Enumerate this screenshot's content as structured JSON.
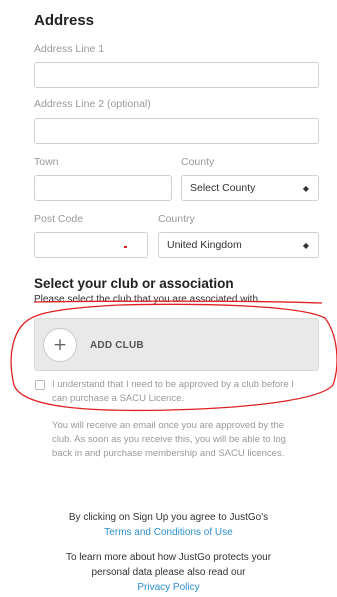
{
  "address": {
    "title": "Address",
    "line1_label": "Address Line 1",
    "line2_label": "Address Line 2 (optional)",
    "town_label": "Town",
    "county_label": "County",
    "county_value": "Select County",
    "postcode_label": "Post Code",
    "country_label": "Country",
    "country_value": "United Kingdom"
  },
  "club": {
    "title": "Select your club or association",
    "subtitle": "Please select the club that you are associated with.",
    "add_club_label": "ADD CLUB",
    "plus_symbol": "+",
    "checkbox_label_1": "I understand that I need to be approved by a club before I",
    "checkbox_label_2": "can purchase a SACU Licence.",
    "info_1": "You will receive an email once you are approved by the",
    "info_2": "club. As soon as you receive this, you will be able to log",
    "info_3": "back in and purchase membership and SACU licences."
  },
  "footer": {
    "terms_intro": "By clicking on Sign Up you agree to JustGo's",
    "terms_link": "Terms and Conditions of Use",
    "privacy_intro_1": "To learn more about how JustGo protects your",
    "privacy_intro_2": "personal data please also read our",
    "privacy_link": "Privacy Policy"
  },
  "colors": {
    "annotation": "#e02020",
    "link": "#2a8fcf"
  }
}
